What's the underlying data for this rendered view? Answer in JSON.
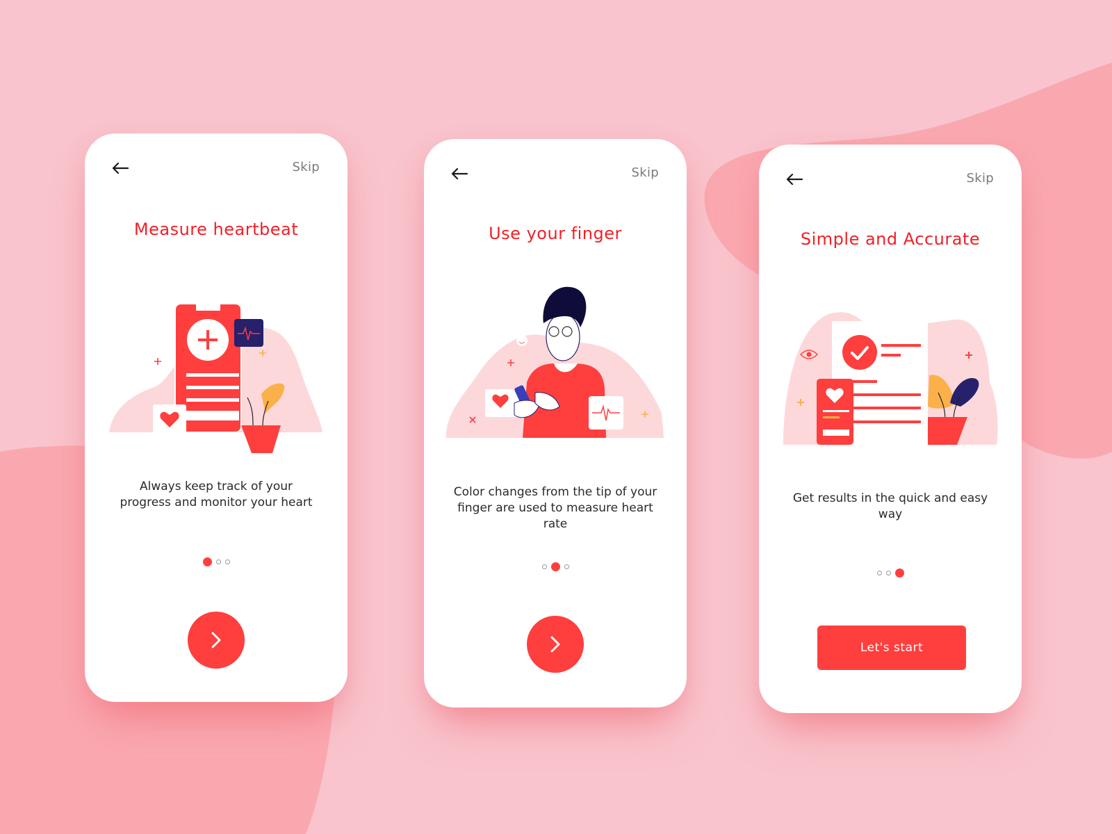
{
  "colors": {
    "background": "#f9c4cd",
    "background_blob": "#faa8b0",
    "accent": "#ff3e3e",
    "title": "#f21f26",
    "navy": "#27206b",
    "yellow": "#fbb04a",
    "illustration_bg": "#fdd8da"
  },
  "screens": [
    {
      "back_icon": "arrow-left-icon",
      "skip_label": "Skip",
      "title": "Measure heartbeat",
      "illustration": "phone-with-heart-monitor",
      "description": "Always keep track of your progress and monitor your heart",
      "pagination": {
        "total": 3,
        "active": 1
      },
      "action": {
        "type": "next",
        "icon": "chevron-right-icon"
      }
    },
    {
      "back_icon": "arrow-left-icon",
      "skip_label": "Skip",
      "title": "Use your finger",
      "illustration": "woman-using-phone",
      "description": "Color changes from the tip of your finger are used to measure heart rate",
      "pagination": {
        "total": 3,
        "active": 2
      },
      "action": {
        "type": "next",
        "icon": "chevron-right-icon"
      }
    },
    {
      "back_icon": "arrow-left-icon",
      "skip_label": "Skip",
      "title": "Simple and Accurate",
      "illustration": "checked-report",
      "description": "Get results in the quick and easy way",
      "pagination": {
        "total": 3,
        "active": 3
      },
      "action": {
        "type": "start",
        "label": "Let's start"
      }
    }
  ]
}
